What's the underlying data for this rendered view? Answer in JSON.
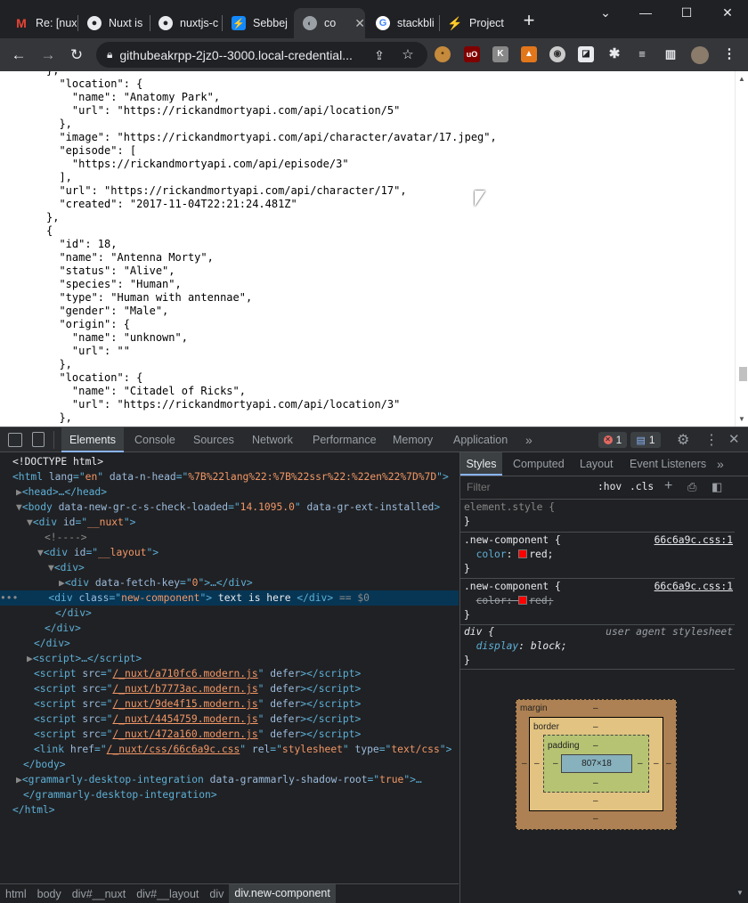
{
  "browser": {
    "tabs": [
      {
        "title": "Re: [nux",
        "icon": "gmail-icon"
      },
      {
        "title": "Nuxt is",
        "icon": "github-icon"
      },
      {
        "title": "nuxtjs-c",
        "icon": "github-icon"
      },
      {
        "title": "Sebbej",
        "icon": "stackblitz-icon"
      },
      {
        "title": "co",
        "icon": "globe-icon"
      },
      {
        "title": "stackbli",
        "icon": "google-icon"
      },
      {
        "title": "Project",
        "icon": "stackblitz-icon"
      }
    ],
    "new_tab": "+",
    "url": "githubeakrpp-2jz0--3000.local-credential..."
  },
  "page": {
    "json_lines": [
      "},",
      "  \"location\": {",
      "    \"name\": \"Anatomy Park\",",
      "    \"url\": \"https://rickandmortyapi.com/api/location/5\"",
      "  },",
      "  \"image\": \"https://rickandmortyapi.com/api/character/avatar/17.jpeg\",",
      "  \"episode\": [",
      "    \"https://rickandmortyapi.com/api/episode/3\"",
      "  ],",
      "  \"url\": \"https://rickandmortyapi.com/api/character/17\",",
      "  \"created\": \"2017-11-04T22:21:24.481Z\"",
      "},",
      "{",
      "  \"id\": 18,",
      "  \"name\": \"Antenna Morty\",",
      "  \"status\": \"Alive\",",
      "  \"species\": \"Human\",",
      "  \"type\": \"Human with antennae\",",
      "  \"gender\": \"Male\",",
      "  \"origin\": {",
      "    \"name\": \"unknown\",",
      "    \"url\": \"\"",
      "  },",
      "  \"location\": {",
      "    \"name\": \"Citadel of Ricks\",",
      "    \"url\": \"https://rickandmortyapi.com/api/location/3\"",
      "  },"
    ]
  },
  "devtools": {
    "tabs": [
      "Elements",
      "Console",
      "Sources",
      "Network",
      "Performance",
      "Memory",
      "Application"
    ],
    "more": "»",
    "error_count": "1",
    "message_count": "1",
    "dom": {
      "doctype": "<!DOCTYPE html>",
      "html_lang": "en",
      "html_nhead": "%7B%22lang%22:%7B%22ssr%22:%22en%22%7D%7D",
      "head": "<head>…</head>",
      "body_loaded": "14.1095.0",
      "nuxt_id": "__nuxt",
      "comment": "<!---->",
      "layout_id": "__layout",
      "fetch_key": "0",
      "component_class": "new-component",
      "component_text": " text is here ",
      "dollar": "== $0",
      "scripts": [
        "/_nuxt/a710fc6.modern.js",
        "/_nuxt/b7773ac.modern.js",
        "/_nuxt/9de4f15.modern.js",
        "/_nuxt/4454759.modern.js",
        "/_nuxt/472a160.modern.js"
      ],
      "css": "/_nuxt/css/66c6a9c.css",
      "grammarly": "true"
    },
    "breadcrumbs": [
      "html",
      "body",
      "div#__nuxt",
      "div#__layout",
      "div",
      "div.new-component"
    ],
    "styles": {
      "tabs": [
        "Styles",
        "Computed",
        "Layout",
        "Event Listeners"
      ],
      "filter_placeholder": "Filter",
      "hov": ":hov",
      "cls": ".cls",
      "element_style": "element.style {",
      "rule_selector": ".new-component {",
      "rule_source": "66c6a9c.css:1",
      "prop_color": "color",
      "val_red": "red;",
      "ua_selector": "div {",
      "ua_label": "user agent stylesheet",
      "prop_display": "display",
      "val_block": "block;",
      "box": {
        "margin": "margin",
        "border": "border",
        "padding": "padding",
        "content": "807×18",
        "dash": "–"
      }
    }
  }
}
